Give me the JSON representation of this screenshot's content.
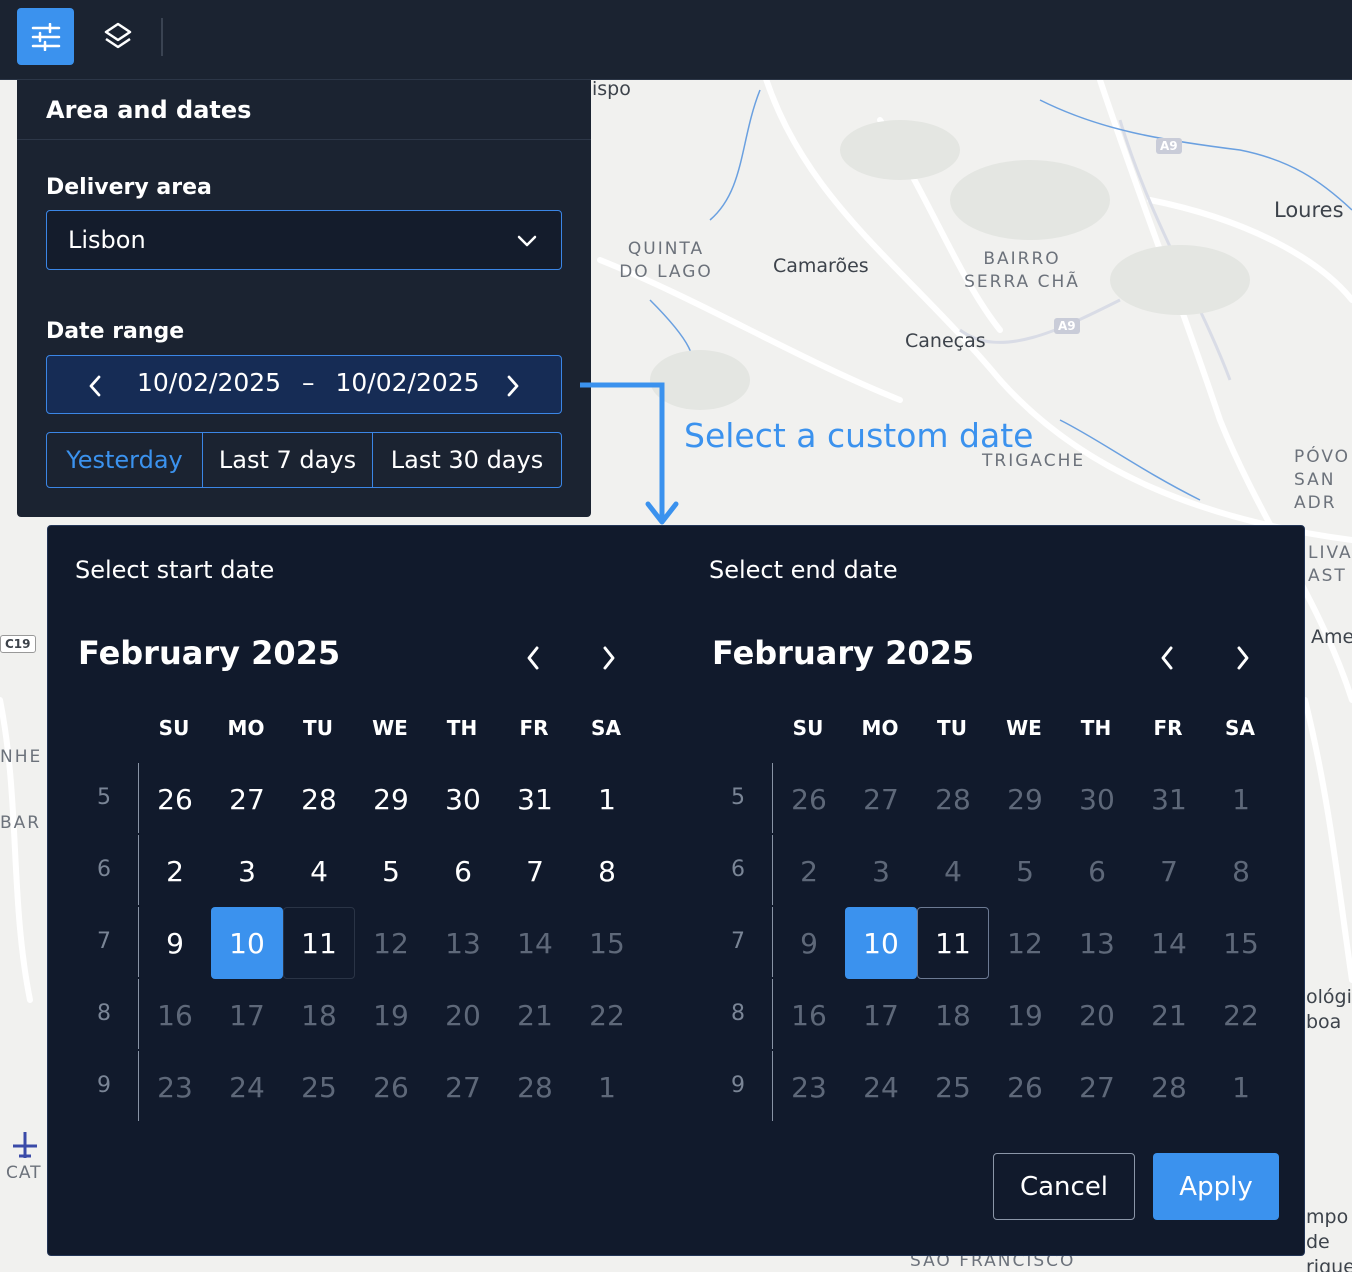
{
  "map": {
    "labels": [
      {
        "text": "Loures",
        "caps": false
      },
      {
        "text": "Camarões",
        "caps": false
      },
      {
        "text": "Caneças",
        "caps": false
      },
      {
        "text": "QUINTA DO LAGO",
        "caps": true
      },
      {
        "text": "BAIRRO SERRA CHÃ",
        "caps": true
      },
      {
        "text": "TRIGACHE",
        "caps": true
      },
      {
        "text": "PÓVO SAN ADR",
        "caps": true
      },
      {
        "text": "LIVA AST",
        "caps": true
      },
      {
        "text": "Ame",
        "caps": false
      },
      {
        "text": "ológic boa",
        "caps": false
      },
      {
        "text": "mpo de rique",
        "caps": false
      },
      {
        "text": "SÃO FRANCISCO",
        "caps": true
      },
      {
        "text": "CAT",
        "caps": true
      },
      {
        "text": "NHE",
        "caps": true
      },
      {
        "text": "BAR",
        "caps": true
      },
      {
        "text": "ispo",
        "caps": false
      }
    ],
    "shields": [
      "A9",
      "A9",
      "C19"
    ],
    "airport_icon": "airplane-icon"
  },
  "toolbar": {
    "filters_icon": "sliders-icon",
    "layers_icon": "layers-icon"
  },
  "panel": {
    "title": "Area and dates",
    "delivery_label": "Delivery area",
    "delivery_value": "Lisbon",
    "date_range_label": "Date range",
    "range_start": "10/02/2025",
    "range_sep": "–",
    "range_end": "10/02/2025",
    "presets": [
      {
        "label": "Yesterday",
        "active": true
      },
      {
        "label": "Last 7 days",
        "active": false
      },
      {
        "label": "Last 30 days",
        "active": false
      }
    ]
  },
  "annotation": {
    "text": "Select a custom date",
    "color": "#3b92ee"
  },
  "picker": {
    "weekdays": [
      "SU",
      "MO",
      "TU",
      "WE",
      "TH",
      "FR",
      "SA"
    ],
    "calendars": [
      {
        "heading": "Select start date",
        "month": "February 2025",
        "weeks": [
          {
            "num": "5",
            "days": [
              [
                "26",
                "cur"
              ],
              [
                "27",
                "cur"
              ],
              [
                "28",
                "cur"
              ],
              [
                "29",
                "cur"
              ],
              [
                "30",
                "cur"
              ],
              [
                "31",
                "cur"
              ],
              [
                "1",
                "cur"
              ]
            ]
          },
          {
            "num": "6",
            "days": [
              [
                "2",
                "cur"
              ],
              [
                "3",
                "cur"
              ],
              [
                "4",
                "cur"
              ],
              [
                "5",
                "cur"
              ],
              [
                "6",
                "cur"
              ],
              [
                "7",
                "cur"
              ],
              [
                "8",
                "cur"
              ]
            ]
          },
          {
            "num": "7",
            "days": [
              [
                "9",
                "cur"
              ],
              [
                "10",
                "sel"
              ],
              [
                "11",
                "hover"
              ],
              [
                "12",
                "dim"
              ],
              [
                "13",
                "dim"
              ],
              [
                "14",
                "dim"
              ],
              [
                "15",
                "dim"
              ]
            ]
          },
          {
            "num": "8",
            "days": [
              [
                "16",
                "dim"
              ],
              [
                "17",
                "dim"
              ],
              [
                "18",
                "dim"
              ],
              [
                "19",
                "dim"
              ],
              [
                "20",
                "dim"
              ],
              [
                "21",
                "dim"
              ],
              [
                "22",
                "dim"
              ]
            ]
          },
          {
            "num": "9",
            "days": [
              [
                "23",
                "dim"
              ],
              [
                "24",
                "dim"
              ],
              [
                "25",
                "dim"
              ],
              [
                "26",
                "dim"
              ],
              [
                "27",
                "dim"
              ],
              [
                "28",
                "dim"
              ],
              [
                "1",
                "dim"
              ]
            ]
          }
        ]
      },
      {
        "heading": "Select end date",
        "month": "February 2025",
        "weeks": [
          {
            "num": "5",
            "days": [
              [
                "26",
                "dim"
              ],
              [
                "27",
                "dim"
              ],
              [
                "28",
                "dim"
              ],
              [
                "29",
                "dim"
              ],
              [
                "30",
                "dim"
              ],
              [
                "31",
                "dim"
              ],
              [
                "1",
                "dim"
              ]
            ]
          },
          {
            "num": "6",
            "days": [
              [
                "2",
                "dim"
              ],
              [
                "3",
                "dim"
              ],
              [
                "4",
                "dim"
              ],
              [
                "5",
                "dim"
              ],
              [
                "6",
                "dim"
              ],
              [
                "7",
                "dim"
              ],
              [
                "8",
                "dim"
              ]
            ]
          },
          {
            "num": "7",
            "days": [
              [
                "9",
                "dim"
              ],
              [
                "10",
                "sel"
              ],
              [
                "11",
                "outline"
              ],
              [
                "12",
                "dim"
              ],
              [
                "13",
                "dim"
              ],
              [
                "14",
                "dim"
              ],
              [
                "15",
                "dim"
              ]
            ]
          },
          {
            "num": "8",
            "days": [
              [
                "16",
                "dim"
              ],
              [
                "17",
                "dim"
              ],
              [
                "18",
                "dim"
              ],
              [
                "19",
                "dim"
              ],
              [
                "20",
                "dim"
              ],
              [
                "21",
                "dim"
              ],
              [
                "22",
                "dim"
              ]
            ]
          },
          {
            "num": "9",
            "days": [
              [
                "23",
                "dim"
              ],
              [
                "24",
                "dim"
              ],
              [
                "25",
                "dim"
              ],
              [
                "26",
                "dim"
              ],
              [
                "27",
                "dim"
              ],
              [
                "28",
                "dim"
              ],
              [
                "1",
                "dim"
              ]
            ]
          }
        ]
      }
    ],
    "cancel_label": "Cancel",
    "apply_label": "Apply",
    "accent_color": "#3b92ee"
  }
}
